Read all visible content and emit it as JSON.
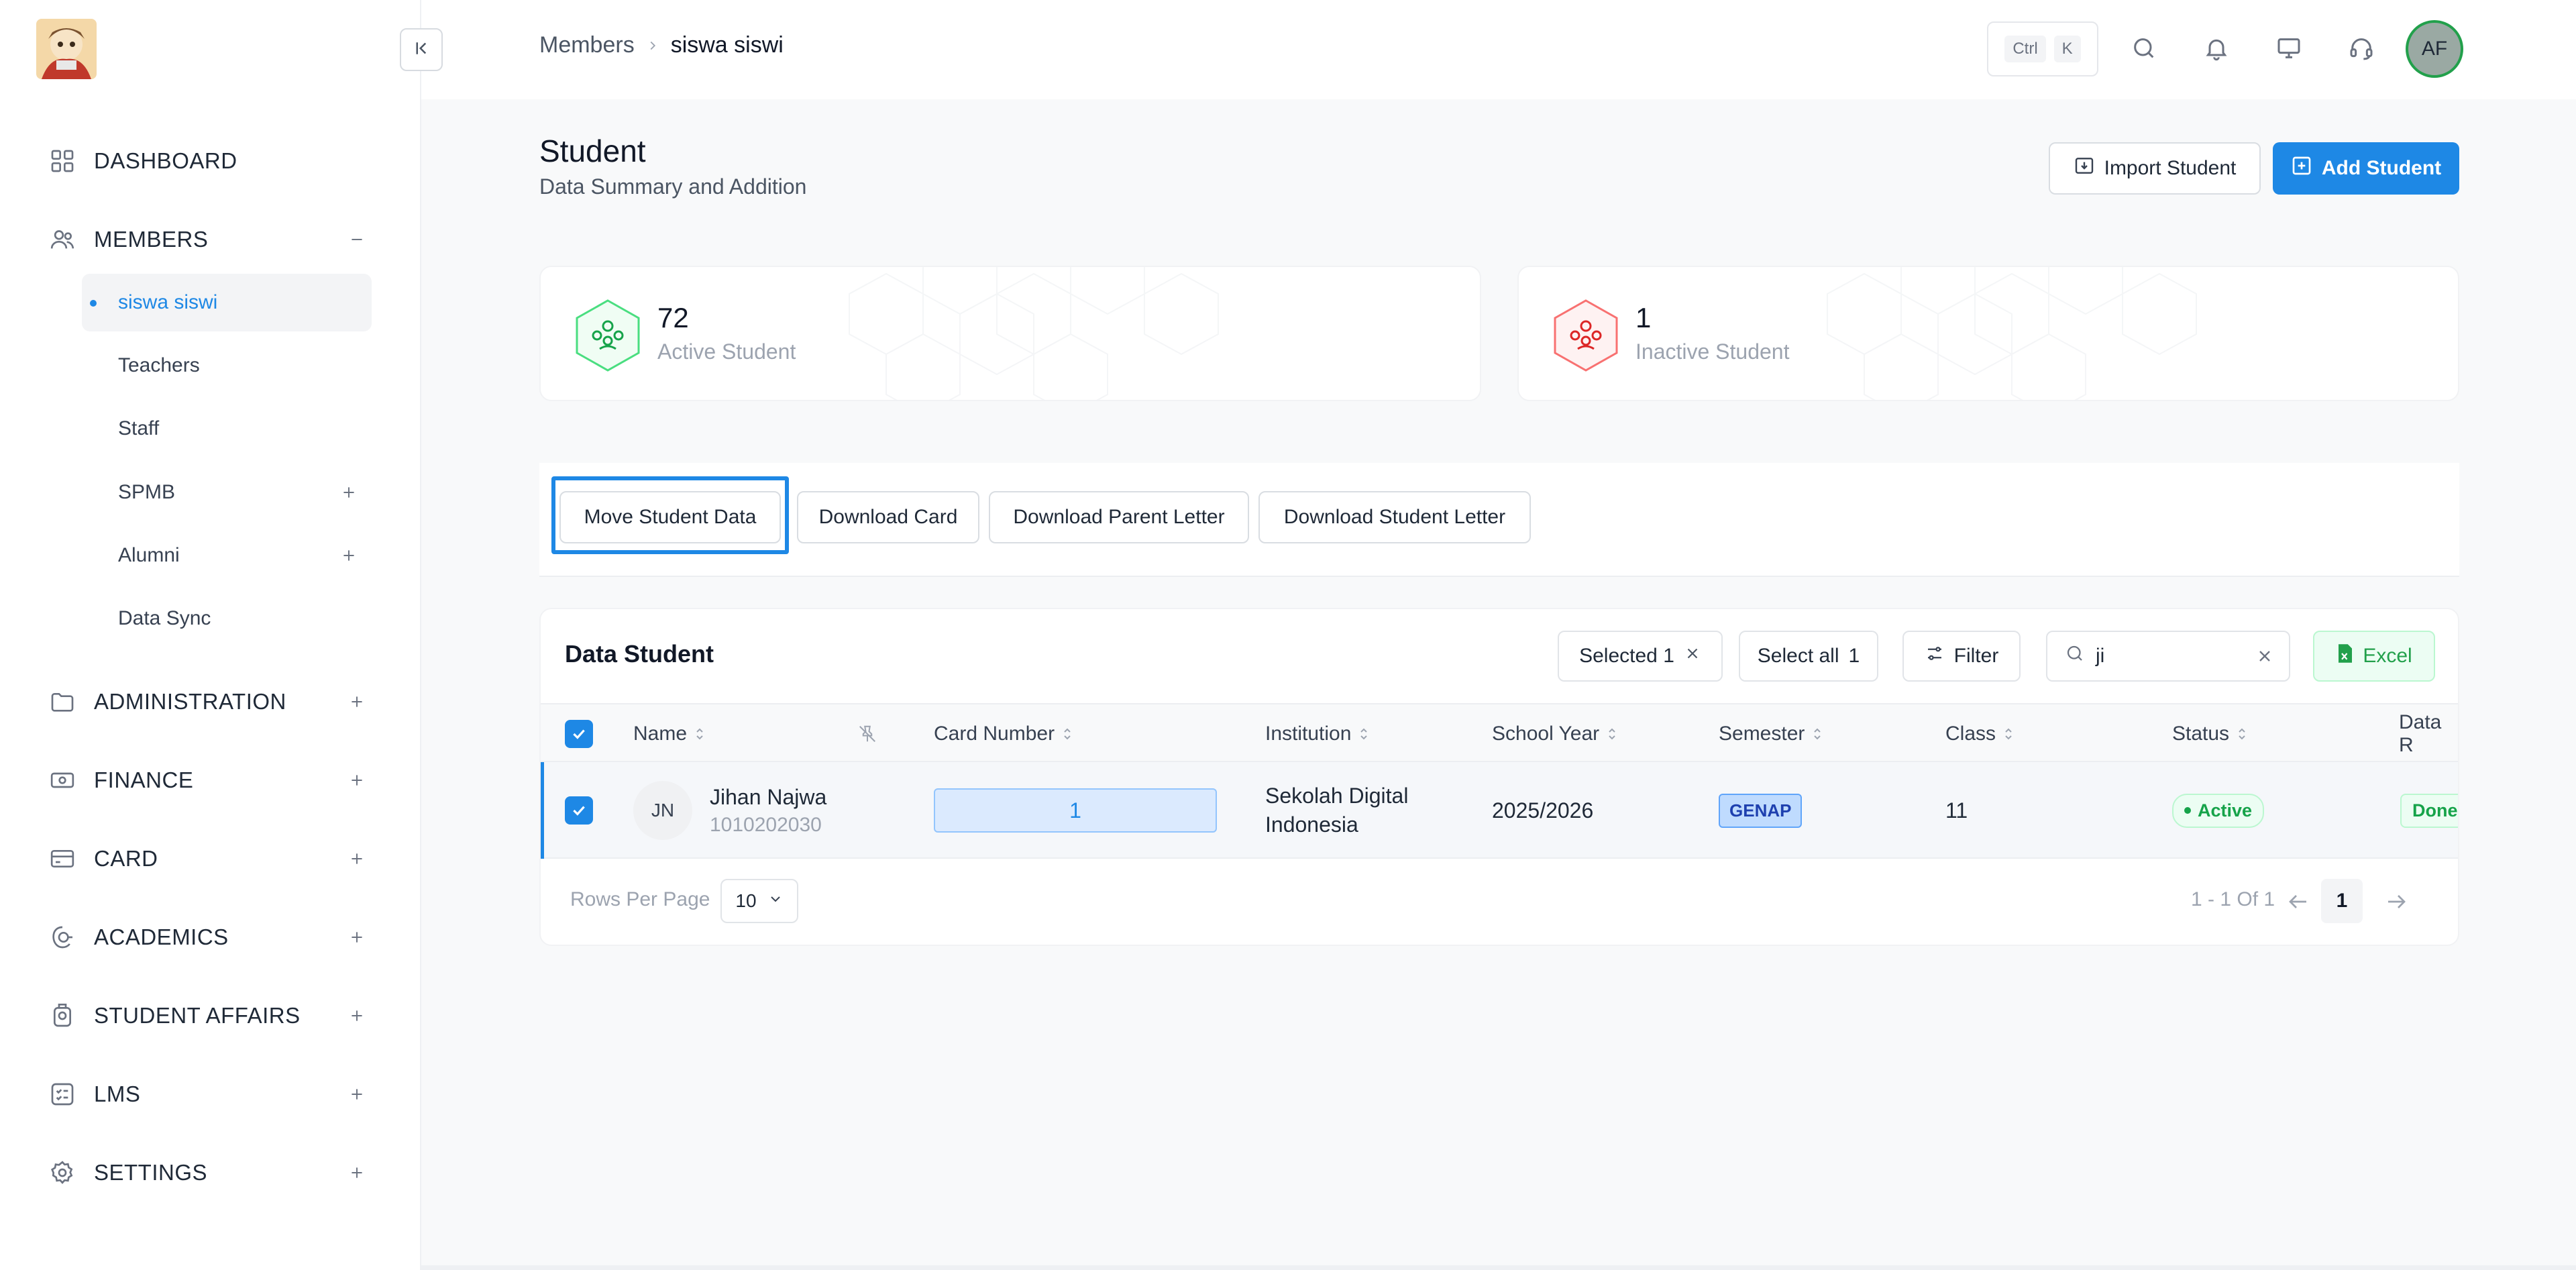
{
  "topbar": {
    "breadcrumb": [
      "Members",
      "siswa siswi"
    ],
    "shortcut_keys": [
      "Ctrl",
      "K"
    ],
    "user_initials": "AF"
  },
  "sidebar": {
    "items": [
      {
        "label": "DASHBOARD",
        "icon": "grid-icon"
      },
      {
        "label": "MEMBERS",
        "icon": "users-icon",
        "expanded": true
      },
      {
        "label": "ADMINISTRATION",
        "icon": "folder-icon"
      },
      {
        "label": "FINANCE",
        "icon": "money-icon"
      },
      {
        "label": "CARD",
        "icon": "card-icon"
      },
      {
        "label": "ACADEMICS",
        "icon": "academics-icon"
      },
      {
        "label": "STUDENT AFFAIRS",
        "icon": "badge-icon"
      },
      {
        "label": "LMS",
        "icon": "checklist-icon"
      },
      {
        "label": "SETTINGS",
        "icon": "gear-icon"
      }
    ],
    "member_subitems": [
      {
        "label": "siswa siswi",
        "active": true
      },
      {
        "label": "Teachers"
      },
      {
        "label": "Staff"
      },
      {
        "label": "SPMB"
      },
      {
        "label": "Alumni"
      },
      {
        "label": "Data Sync"
      }
    ]
  },
  "page": {
    "title": "Student",
    "subtitle": "Data Summary and Addition",
    "import_label": "Import Student",
    "add_label": "Add Student"
  },
  "stats": [
    {
      "value": "72",
      "label": "Active Student",
      "color": "#22a04b"
    },
    {
      "value": "1",
      "label": "Inactive Student",
      "color": "#ef4444"
    }
  ],
  "actions": [
    "Move Student Data",
    "Download Card",
    "Download Parent Letter",
    "Download Student Letter"
  ],
  "table": {
    "title": "Data Student",
    "selected_label": "Selected 1",
    "select_all_label": "Select all",
    "select_all_count": "1",
    "filter_label": "Filter",
    "search_value": "ji",
    "excel_label": "Excel",
    "columns": [
      "Name",
      "Card Number",
      "Institution",
      "School Year",
      "Semester",
      "Class",
      "Status",
      "Data R"
    ],
    "rows": [
      {
        "initials": "JN",
        "name": "Jihan Najwa",
        "id": "1010202030",
        "card_number": "1",
        "institution_line1": "Sekolah Digital",
        "institution_line2": "Indonesia",
        "school_year": "2025/2026",
        "semester": "GENAP",
        "class": "11",
        "status": "Active",
        "data_r": "Done"
      }
    ],
    "rows_per_page_label": "Rows Per Page",
    "rows_per_page": "10",
    "page_info": "1 - 1 Of 1",
    "current_page": "1"
  }
}
